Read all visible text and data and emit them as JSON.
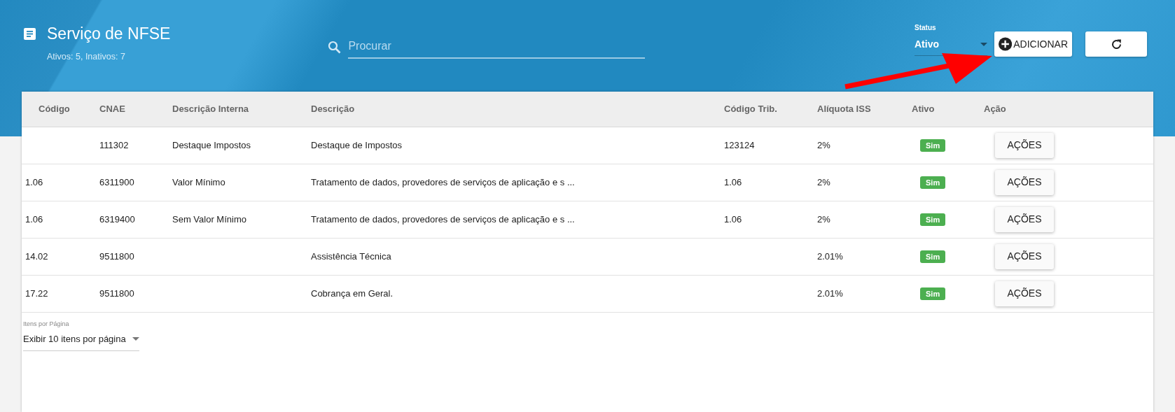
{
  "header": {
    "title": "Serviço de NFSE",
    "subtitle": "Ativos: 5, Inativos: 7"
  },
  "search": {
    "placeholder": "Procurar"
  },
  "status_filter": {
    "label": "Status",
    "value": "Ativo"
  },
  "buttons": {
    "add": "ADICIONAR"
  },
  "table": {
    "columns": [
      "Código",
      "CNAE",
      "Descrição Interna",
      "Descrição",
      "Código Trib.",
      "Alíquota ISS",
      "Ativo",
      "Ação"
    ],
    "rows": [
      {
        "codigo": "",
        "cnae": "111302",
        "descricao_interna": "Destaque Impostos",
        "descricao": "Destaque de Impostos",
        "codigo_trib": "123124",
        "aliquota": "2%",
        "ativo": "Sim",
        "acao": "AÇÕES"
      },
      {
        "codigo": "1.06",
        "cnae": "6311900",
        "descricao_interna": "Valor Mínimo",
        "descricao": "Tratamento de dados, provedores de serviços de aplicação e s ...",
        "codigo_trib": "1.06",
        "aliquota": "2%",
        "ativo": "Sim",
        "acao": "AÇÕES"
      },
      {
        "codigo": "1.06",
        "cnae": "6319400",
        "descricao_interna": "Sem Valor Mínimo",
        "descricao": "Tratamento de dados, provedores de serviços de aplicação e s ...",
        "codigo_trib": "1.06",
        "aliquota": "2%",
        "ativo": "Sim",
        "acao": "AÇÕES"
      },
      {
        "codigo": "14.02",
        "cnae": "9511800",
        "descricao_interna": "",
        "descricao": "Assistência Técnica",
        "codigo_trib": "",
        "aliquota": "2.01%",
        "ativo": "Sim",
        "acao": "AÇÕES"
      },
      {
        "codigo": "17.22",
        "cnae": "9511800",
        "descricao_interna": "",
        "descricao": "Cobrança em Geral.",
        "codigo_trib": "",
        "aliquota": "2.01%",
        "ativo": "Sim",
        "acao": "AÇÕES"
      }
    ]
  },
  "pagination": {
    "label": "Itens por Página",
    "value": "Exibir 10 itens por página"
  }
}
